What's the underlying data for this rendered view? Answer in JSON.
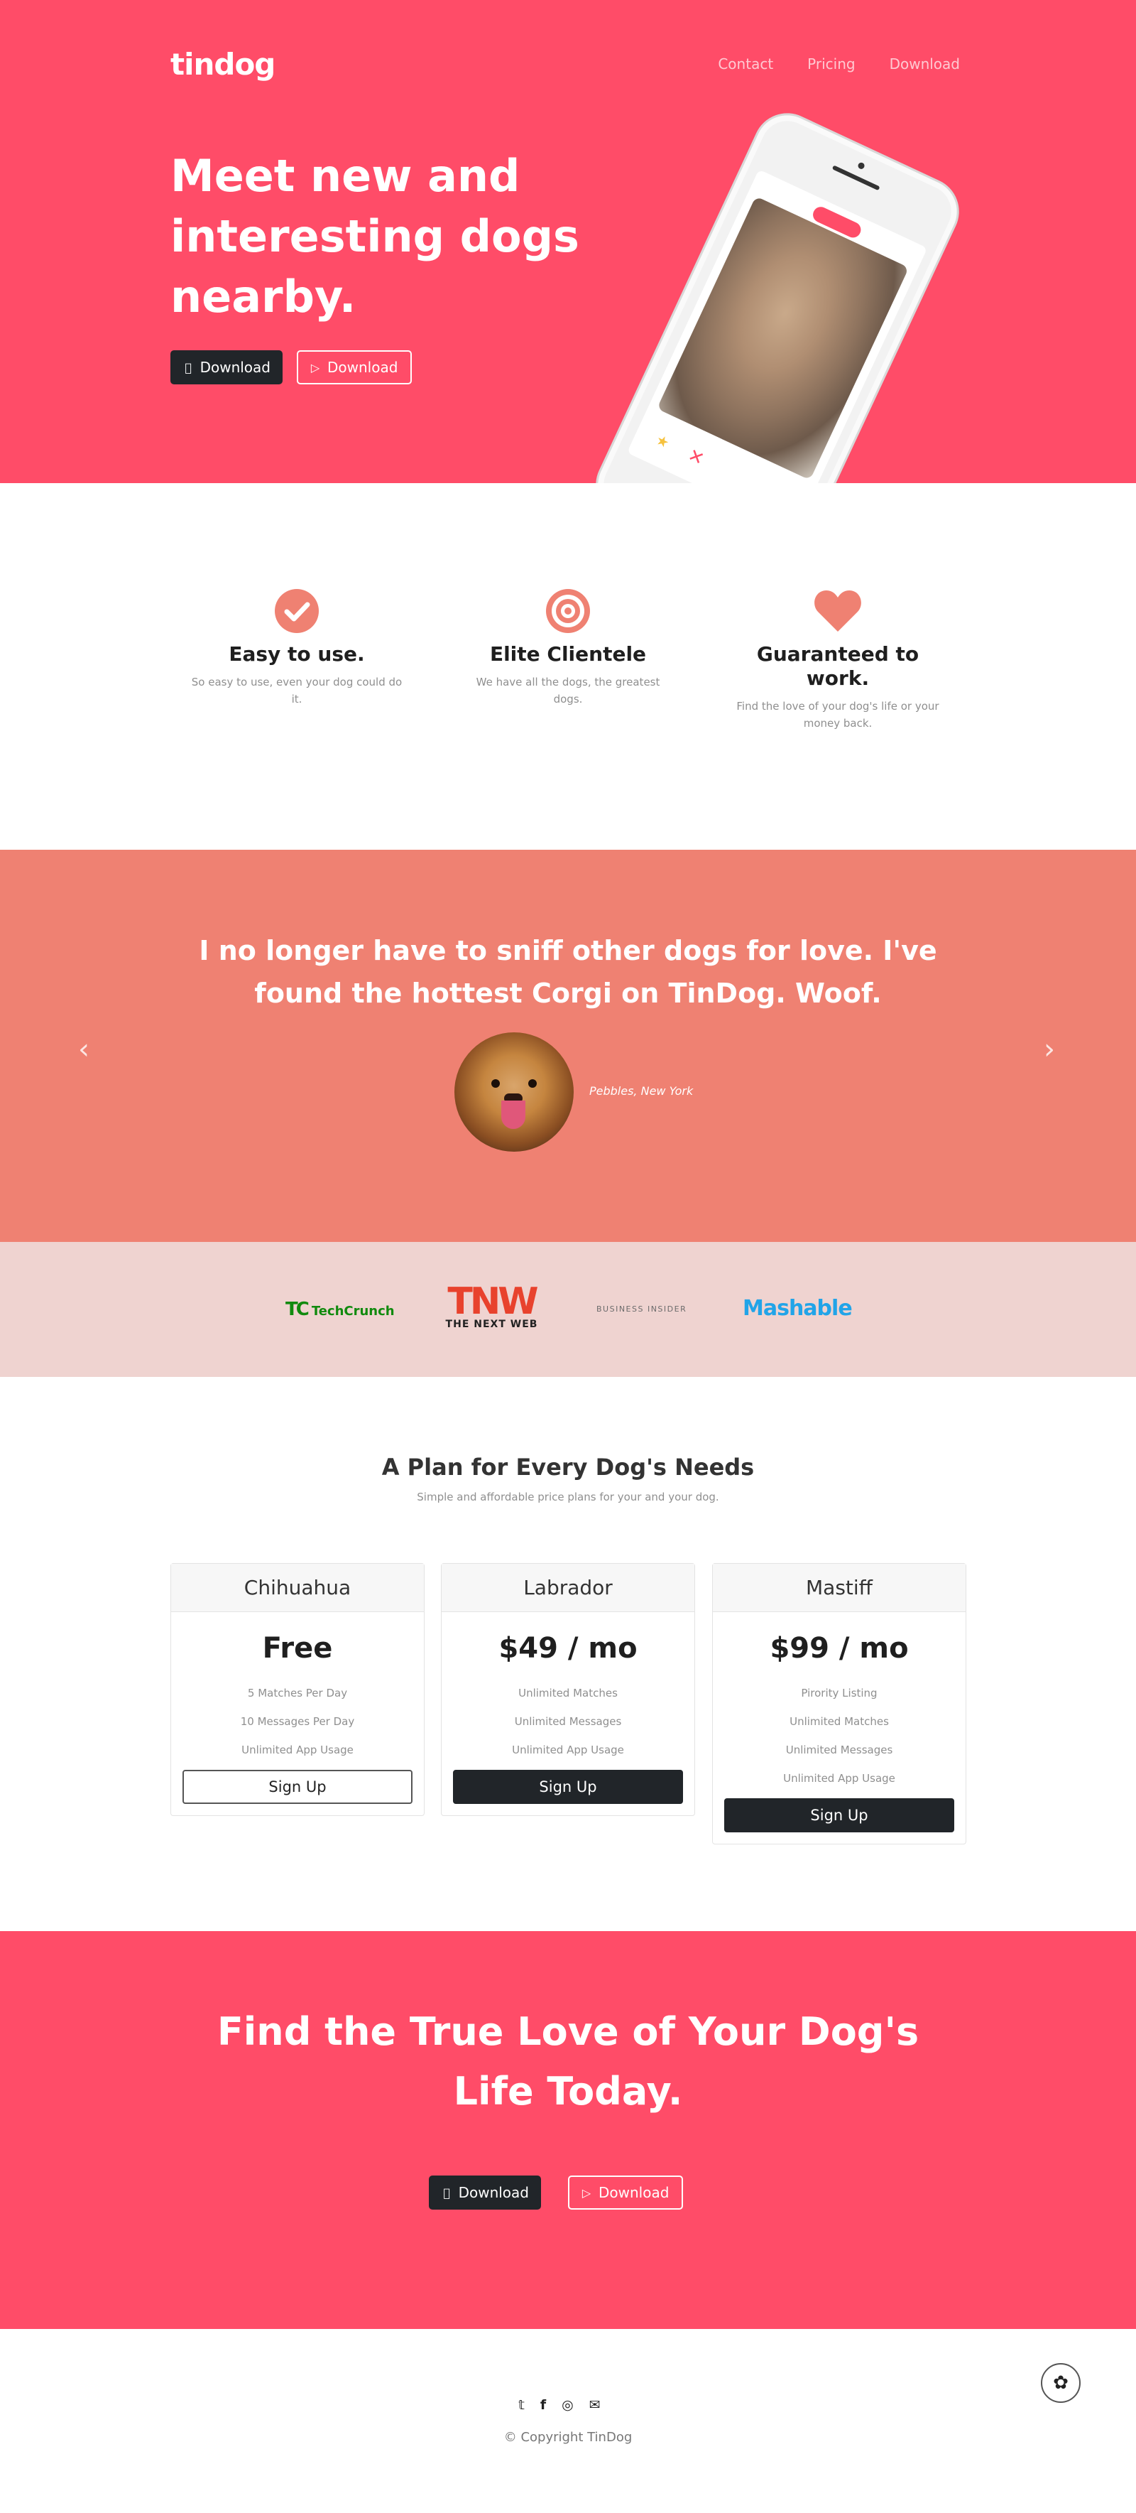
{
  "nav": {
    "brand": "tindog",
    "links": [
      "Contact",
      "Pricing",
      "Download"
    ]
  },
  "hero": {
    "heading": "Meet new and interesting dogs nearby.",
    "download_apple": "Download",
    "download_google": "Download"
  },
  "features": [
    {
      "icon": "check-circle-icon",
      "title": "Easy to use.",
      "text": "So easy to use, even your dog could do it."
    },
    {
      "icon": "bullseye-icon",
      "title": "Elite Clientele",
      "text": "We have all the dogs, the greatest dogs."
    },
    {
      "icon": "heart-icon",
      "title": "Guaranteed to work.",
      "text": "Find the love of your dog's life or your money back."
    }
  ],
  "testimonial": {
    "quote": "I no longer have to sniff other dogs for love. I've found the hottest Corgi on TinDog. Woof.",
    "attribution": "Pebbles, New York"
  },
  "press": {
    "logos": [
      "TechCrunch",
      "TNW",
      "THE NEXT WEB",
      "BUSINESS INSIDER",
      "Mashable"
    ]
  },
  "pricing": {
    "heading": "A Plan for Every Dog's Needs",
    "subheading": "Simple and affordable price plans for your and your dog.",
    "plans": [
      {
        "name": "Chihuahua",
        "price": "Free",
        "features": [
          "5 Matches Per Day",
          "10 Messages Per Day",
          "Unlimited App Usage"
        ],
        "button": "Sign Up"
      },
      {
        "name": "Labrador",
        "price": "$49 / mo",
        "features": [
          "Unlimited Matches",
          "Unlimited Messages",
          "Unlimited App Usage"
        ],
        "button": "Sign Up"
      },
      {
        "name": "Mastiff",
        "price": "$99 / mo",
        "features": [
          "Pirority Listing",
          "Unlimited Matches",
          "Unlimited Messages",
          "Unlimited App Usage"
        ],
        "button": "Sign Up"
      }
    ]
  },
  "cta": {
    "heading": "Find the True Love of Your Dog's Life Today.",
    "download_apple": "Download",
    "download_google": "Download"
  },
  "footer": {
    "icons": [
      "twitter-icon",
      "facebook-icon",
      "instagram-icon",
      "envelope-icon"
    ],
    "copyright": "© Copyright TinDog"
  },
  "colors": {
    "primary": "#ff4c68",
    "testimonial_bg": "#ef8172",
    "press_bg": "#efd3d0",
    "dark": "#212529"
  }
}
